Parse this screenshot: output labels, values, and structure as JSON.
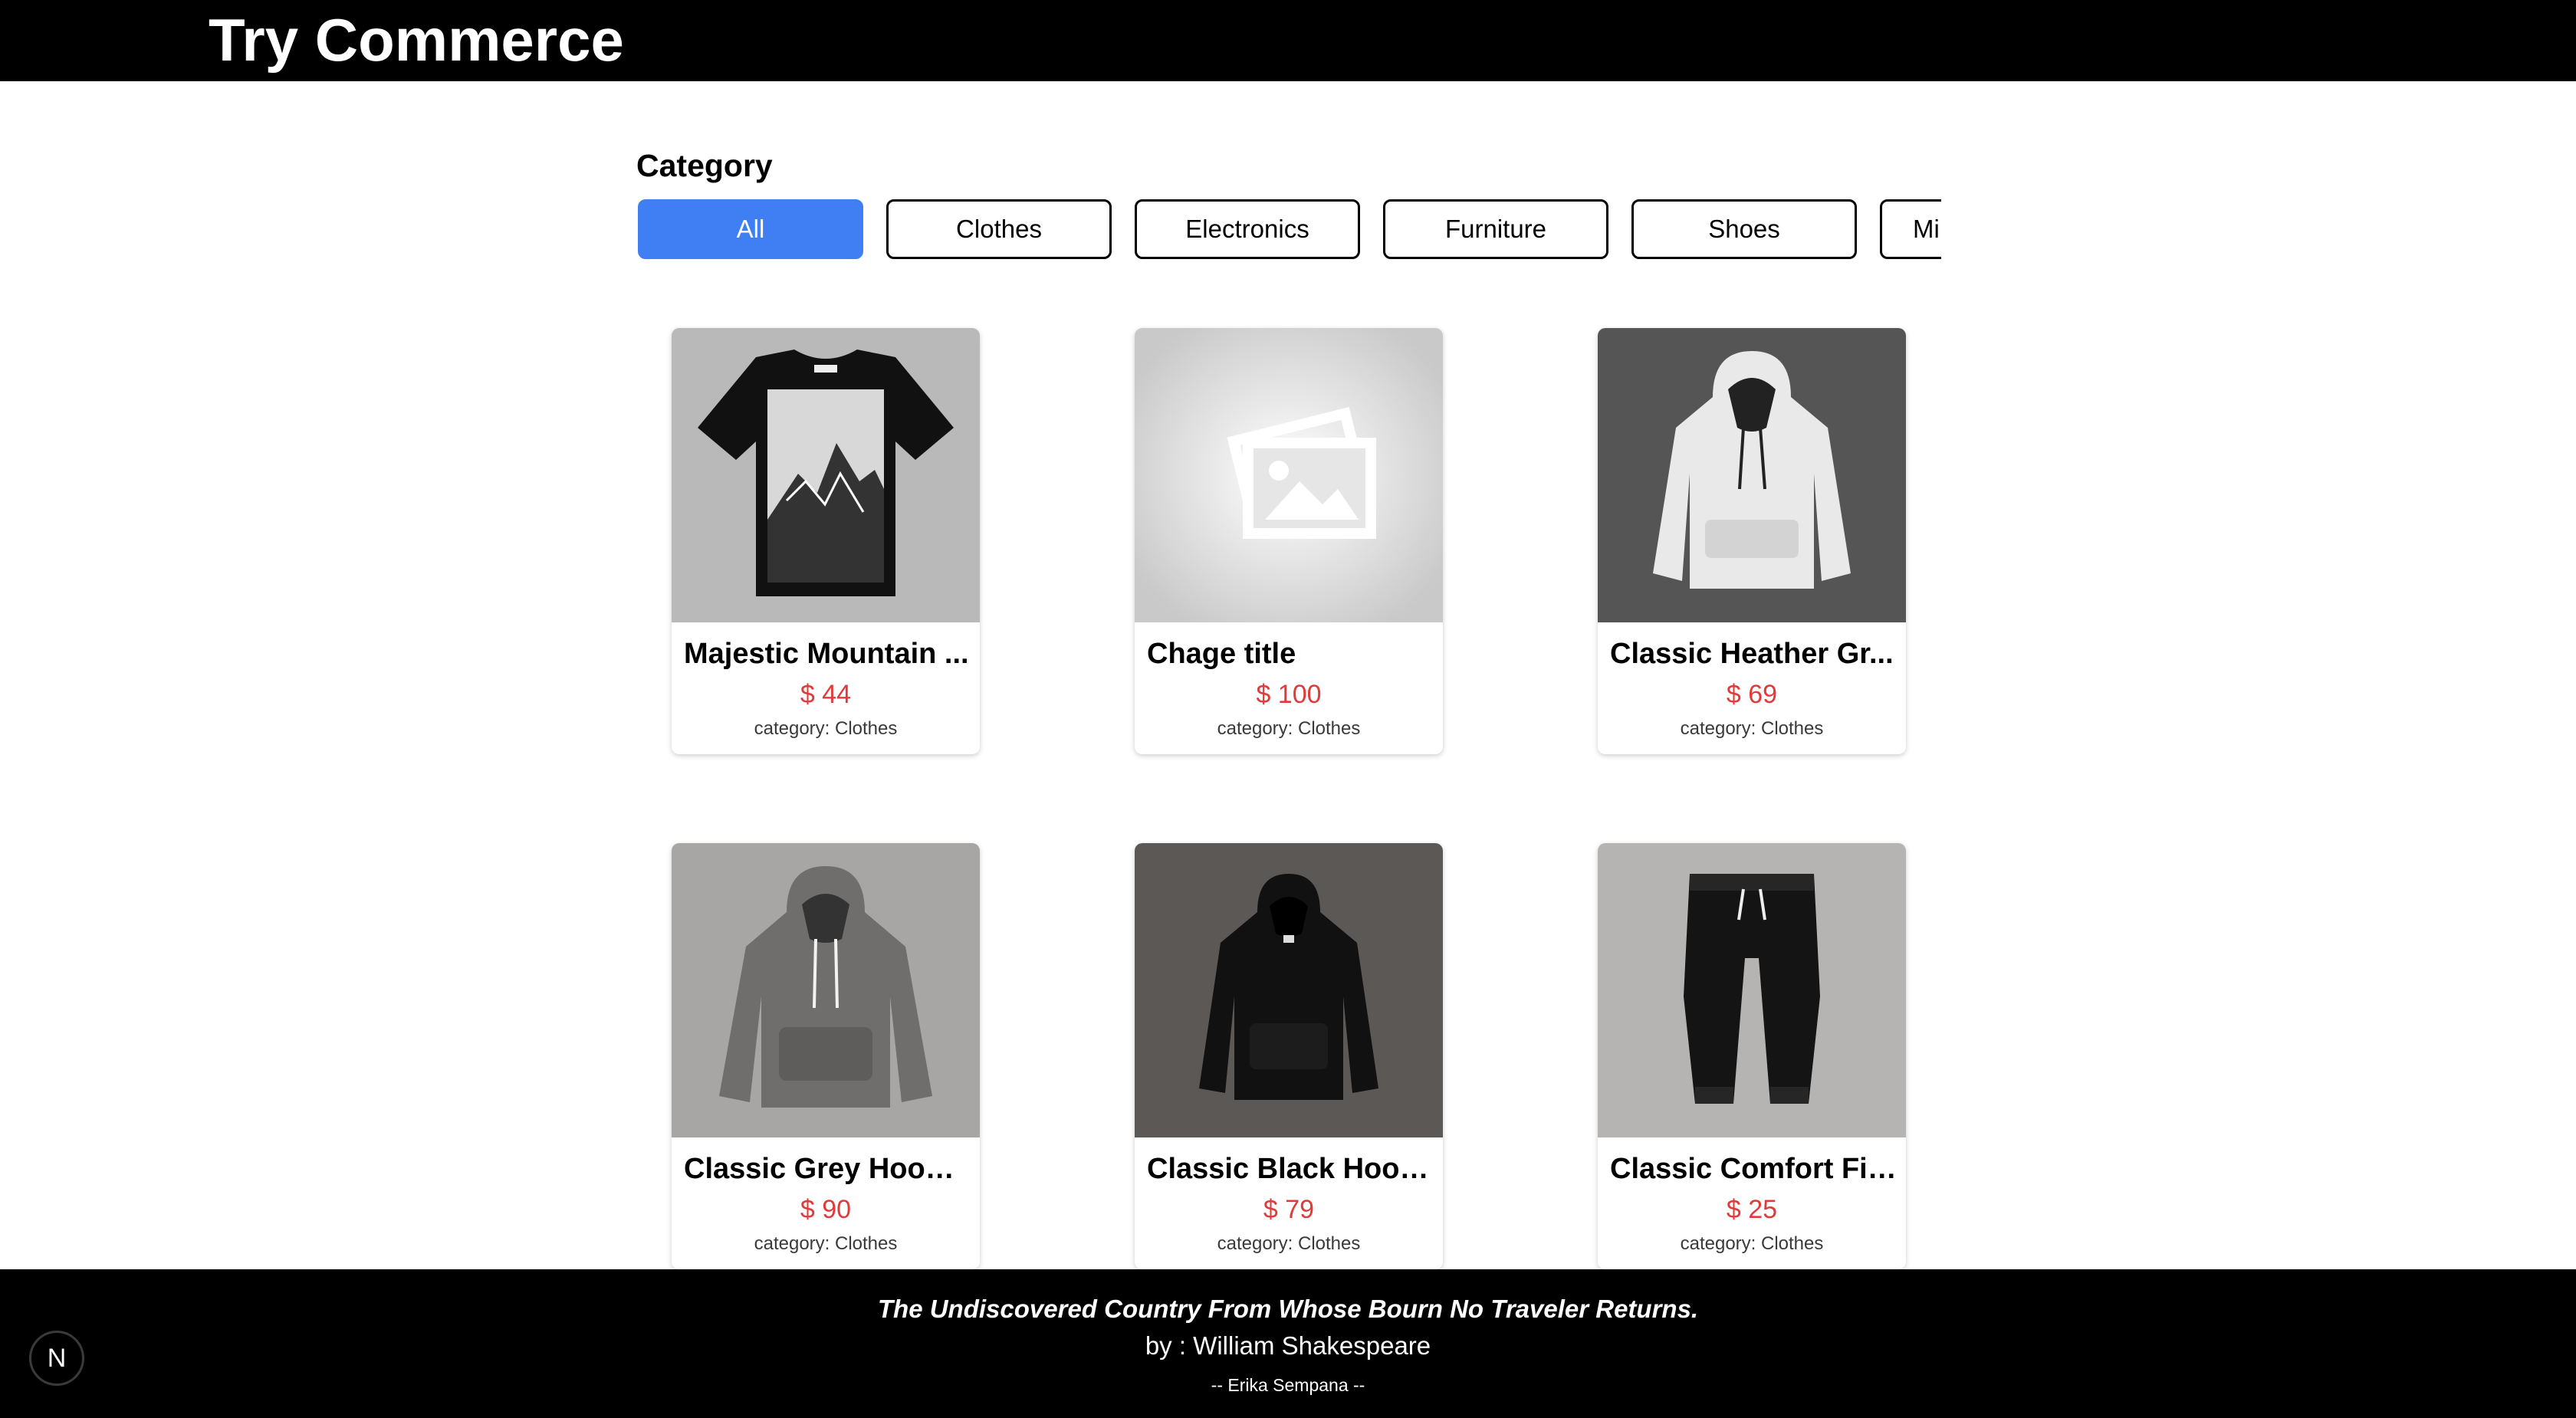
{
  "header": {
    "title": "Try Commerce"
  },
  "category": {
    "heading": "Category",
    "chips": [
      {
        "label": "All",
        "active": true
      },
      {
        "label": "Clothes",
        "active": false
      },
      {
        "label": "Electronics",
        "active": false
      },
      {
        "label": "Furniture",
        "active": false
      },
      {
        "label": "Shoes",
        "active": false
      },
      {
        "label": "Mi",
        "active": false
      }
    ]
  },
  "products": [
    {
      "name": "Majestic Mountain ...",
      "price": "$ 44",
      "category": "category: Clothes",
      "image": "tshirt-mountain"
    },
    {
      "name": "Chage title",
      "price": "$ 100",
      "category": "category: Clothes",
      "image": "placeholder"
    },
    {
      "name": "Classic Heather Gr...",
      "price": "$ 69",
      "category": "category: Clothes",
      "image": "hoodie-white"
    },
    {
      "name": "Classic Grey Hoode...",
      "price": "$ 90",
      "category": "category: Clothes",
      "image": "hoodie-grey"
    },
    {
      "name": "Classic Black Hood...",
      "price": "$ 79",
      "category": "category: Clothes",
      "image": "hoodie-black"
    },
    {
      "name": "Classic Comfort Fit...",
      "price": "$ 25",
      "category": "category: Clothes",
      "image": "joggers-black"
    }
  ],
  "footer": {
    "quote": "The Undiscovered Country From Whose Bourn No Traveler Returns.",
    "author": "by : William Shakespeare",
    "credit": "-- Erika Sempana --"
  },
  "badge": {
    "letter": "N"
  },
  "colors": {
    "accent": "#3f7ff3",
    "price": "#e03a3a",
    "bar": "#000000"
  }
}
